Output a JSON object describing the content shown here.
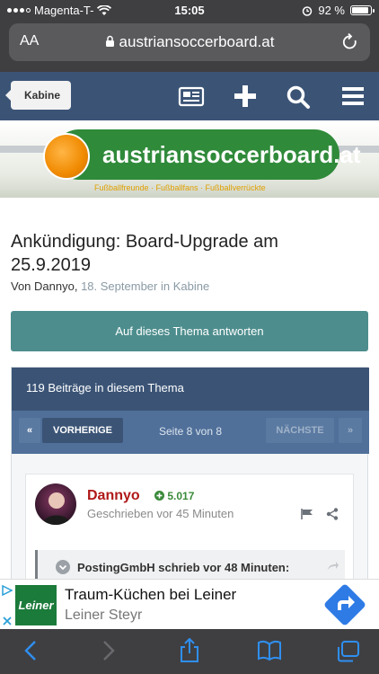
{
  "status": {
    "carrier": "Magenta-T-",
    "time": "15:05",
    "battery": "92 %",
    "battery_level": 0.92
  },
  "browser": {
    "text_size": "AA",
    "url": "austriansoccerboard.at"
  },
  "site": {
    "back_label": "Kabine",
    "logo_text": "austriansoccerboard.at",
    "tagline": "Fußballfreunde · Fußballfans · Fußballverrückte"
  },
  "topic": {
    "title": "Ankündigung: Board-Upgrade am 25.9.2019",
    "by": "Von Dannyo,",
    "date": "18. September in Kabine",
    "reply_button": "Auf dieses Thema antworten"
  },
  "thread": {
    "count": "119 Beiträge in diesem Thema",
    "prev_arrow": "«",
    "prev": "VORHERIGE",
    "page": "Seite 8 von 8",
    "next": "NÄCHSTE",
    "next_arrow": "»"
  },
  "post": {
    "author": "Dannyo",
    "reputation": "5.017",
    "posted": "Geschrieben vor 45 Minuten",
    "quote": "PostingGmbH schrieb vor 48 Minuten:"
  },
  "ad": {
    "logo": "Leiner",
    "title": "Traum-Küchen bei Leiner",
    "subtitle": "Leiner Steyr"
  }
}
